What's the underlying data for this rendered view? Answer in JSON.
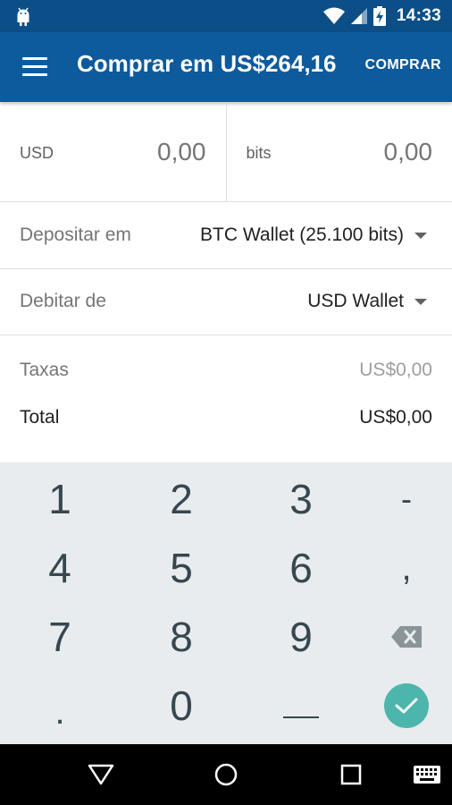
{
  "status_bar": {
    "time": "14:33",
    "icons": [
      "android-icon",
      "wifi-icon",
      "signal-icon",
      "battery-charging-icon"
    ]
  },
  "app_bar": {
    "title": "Comprar em US$264,16",
    "action_label": "COMPRAR",
    "menu_icon": "menu-icon"
  },
  "amounts": {
    "fiat_currency": "USD",
    "fiat_value": "0,00",
    "crypto_currency": "bits",
    "crypto_value": "0,00"
  },
  "deposit": {
    "label": "Depositar em",
    "value": "BTC Wallet (25.100 bits)"
  },
  "debit": {
    "label": "Debitar de",
    "value": "USD Wallet"
  },
  "fees": {
    "fees_label": "Taxas",
    "fees_value": "US$0,00",
    "total_label": "Total",
    "total_value": "US$0,00"
  },
  "keypad": {
    "k1": "1",
    "k2": "2",
    "k3": "3",
    "minus": "-",
    "k4": "4",
    "k5": "5",
    "k6": "6",
    "comma": ",",
    "k7": "7",
    "k8": "8",
    "k9": "9",
    "dot": ".",
    "k0": "0"
  },
  "colors": {
    "status_bar": "#0c4f88",
    "app_bar": "#0d5a9c",
    "keypad_bg": "#e9ecee",
    "confirm": "#4db6ac"
  }
}
